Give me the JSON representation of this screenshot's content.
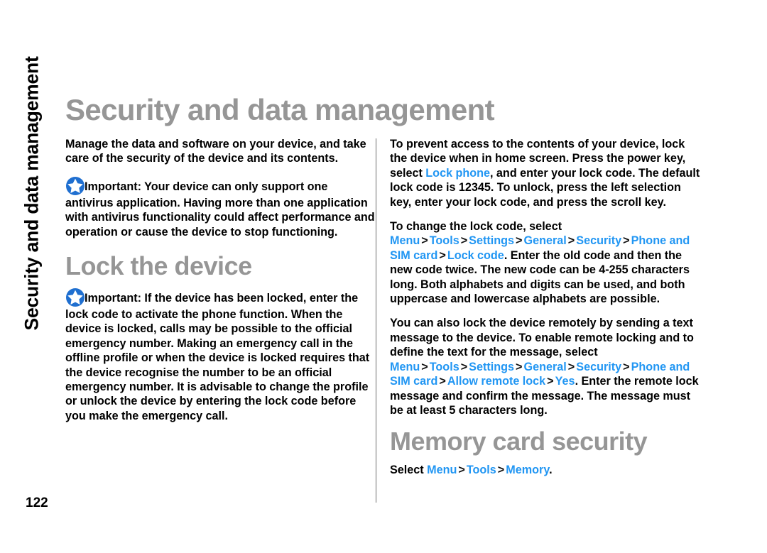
{
  "document": {
    "side_tab_label": "Security and data management",
    "page_title": "Security and data management",
    "page_number": "122",
    "accent_blue": "#2196f3",
    "heading_gray": "#969696",
    "icon": {
      "name": "important-star-icon",
      "circle_color": "#1f6fd0",
      "star_color": "#ffffff"
    }
  },
  "left_column": {
    "intro_paragraph": "Manage the data and software on your device, and take care of the security of the device and its contents.",
    "important_1": {
      "label": "Important:",
      "text": " Your device can only support one antivirus application. Having more than one application with antivirus functionality could affect performance and operation or cause the device to stop functioning."
    },
    "section_heading": "Lock the device",
    "important_2": {
      "label": "Important:",
      "text": " If the device has been locked, enter the lock code to activate the phone function. When the device is locked, calls may be possible to the official emergency number. Making an emergency call in the offline profile or when the device is locked requires that the device recognise the number to be an official emergency number. It is advisable to change the profile or unlock the device by entering the lock code before you make the emergency call."
    }
  },
  "right_column": {
    "para_1": {
      "t1": "To prevent access to the contents of your device, lock the device when in home screen. Press the power key, select ",
      "link1": "Lock phone",
      "t2": ", and enter your lock code. The default lock code is 12345. To unlock, press the left selection key, enter your lock code, and press the scroll key."
    },
    "para_2": {
      "t1": "To change the lock code, select ",
      "link1": "Menu",
      "sep1": ">",
      "link2": "Tools",
      "sep2": ">",
      "link3": "Settings",
      "sep3": ">",
      "link4": "General",
      "sep4": ">",
      "link5": "Security",
      "sep5": ">",
      "link6": "Phone and SIM card",
      "sep6": ">",
      "link7": "Lock code",
      "t2": ". Enter the old code and then the new code twice. The new code can be 4-255 characters long. Both alphabets and digits can be used, and both uppercase and lowercase alphabets are possible."
    },
    "para_3": {
      "t1": "You can also lock the device remotely by sending a text message to the device. To enable remote locking and to define the text for the message, select ",
      "link1": "Menu",
      "sep1": ">",
      "link2": "Tools",
      "sep2": ">",
      "link3": "Settings",
      "sep3": ">",
      "link4": "General",
      "sep4": ">",
      "link5": "Security",
      "sep5": ">",
      "link6": "Phone and SIM card",
      "sep6": ">",
      "link7": "Allow remote lock",
      "sep7": ">",
      "link8": "Yes",
      "t2": ". Enter the remote lock message and confirm the message. The message must be at least 5 characters long."
    },
    "section_heading": "Memory card security",
    "para_4": {
      "t1": "Select ",
      "link1": "Menu",
      "sep1": ">",
      "link2": "Tools",
      "sep2": ">",
      "link3": "Memory",
      "t2": "."
    }
  }
}
